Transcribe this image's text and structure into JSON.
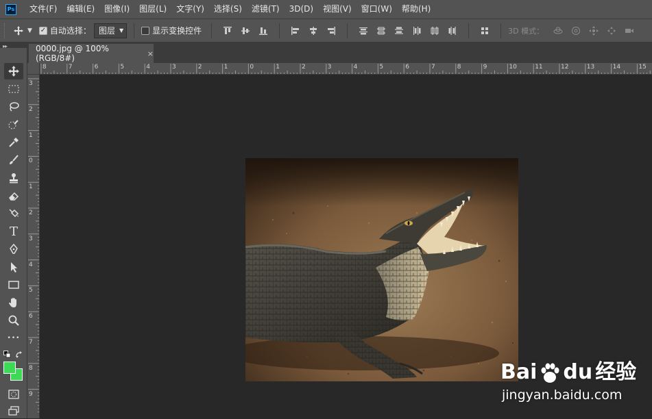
{
  "app": {
    "logo_text": "Ps"
  },
  "menu": [
    "文件(F)",
    "编辑(E)",
    "图像(I)",
    "图层(L)",
    "文字(Y)",
    "选择(S)",
    "滤镜(T)",
    "3D(D)",
    "视图(V)",
    "窗口(W)",
    "帮助(H)"
  ],
  "options": {
    "auto_select_label": "自动选择：",
    "auto_select_checked": true,
    "layer_select_value": "图层",
    "show_transform_label": "显示变换控件",
    "show_transform_checked": false,
    "mode_3d_label": "3D 模式："
  },
  "document": {
    "tab_title": "0000.jpg @ 100%(RGB/8#)",
    "close_glyph": "×"
  },
  "rulers": {
    "top_labels": [
      "8",
      "7",
      "6",
      "5",
      "4",
      "3",
      "2",
      "1",
      "0",
      "1",
      "2",
      "3",
      "4",
      "5",
      "6",
      "7",
      "8",
      "9",
      "10",
      "11",
      "12",
      "13",
      "14",
      "15"
    ],
    "left_labels": [
      "3",
      "2",
      "1",
      "0",
      "1",
      "2",
      "3",
      "4",
      "5",
      "6",
      "7",
      "8",
      "9"
    ]
  },
  "tools": {
    "text_tool_glyph": "T",
    "more_glyph": "•••"
  },
  "colors": {
    "foreground": "#3ddb55",
    "background": "#3ddb55",
    "ui_panel": "#535353",
    "canvas_bg": "#282828"
  },
  "watermark": {
    "brand_left": "Bai",
    "brand_mid": "du",
    "brand_right": "经验",
    "url": "jingyan.baidu.com"
  }
}
